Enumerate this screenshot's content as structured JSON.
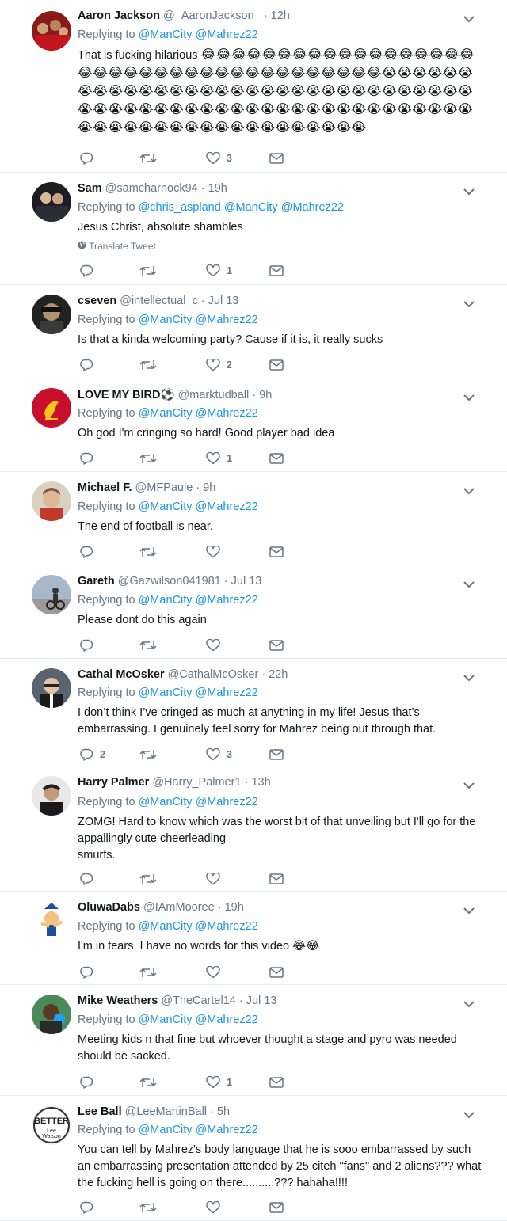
{
  "tweets": [
    {
      "name": "Aaron Jackson",
      "handle": "@_AaronJackson_",
      "time": "12h",
      "replying": "Replying to",
      "mentions": [
        "@ManCity",
        "@Mahrez22"
      ],
      "text": "That is fucking hilarious",
      "emoji_line": "😂😂😂😂😂😂😂😂😂😂😂😂😂😂😂😂😂😂😂😂😂😂😂😂😂😂😂😂😂😂😂😂😂😂😂😂😂😂😭😭😭😭😭😭😭😭😭😭😭😭😭😭😭😭😭😭😭😭😭😭😭😭😭😭😭😭😭😭😭😭😭😭😭😭😭😭😭😭😭😭😭😭😭😭😭😭😭😭😭😭😭😭😭😭😭😭😭😭😭😭😭😭😭😭😭😭😭😭😭😭😭😭😭😭😭",
      "reply_count": "",
      "retweet_count": "",
      "like_count": "3"
    },
    {
      "name": "Sam",
      "handle": "@samcharnock94",
      "time": "19h",
      "replying": "Replying to",
      "mentions": [
        "@chris_aspland",
        "@ManCity",
        "@Mahrez22"
      ],
      "text": "Jesus Christ, absolute shambles",
      "translate": "Translate Tweet",
      "reply_count": "",
      "retweet_count": "",
      "like_count": "1"
    },
    {
      "name": "cseven",
      "handle": "@intellectual_c",
      "time": "Jul 13",
      "replying": "Replying to",
      "mentions": [
        "@ManCity",
        "@Mahrez22"
      ],
      "text": "Is that a kinda welcoming party? Cause if it is, it really sucks",
      "reply_count": "",
      "retweet_count": "",
      "like_count": "2"
    },
    {
      "name": "LOVE MY BIRD⚽",
      "handle": "@marktudball",
      "time": "9h",
      "replying": "Replying to",
      "mentions": [
        "@ManCity",
        "@Mahrez22"
      ],
      "text": "Oh god I'm cringing so hard! Good player bad idea",
      "reply_count": "",
      "retweet_count": "",
      "like_count": "1"
    },
    {
      "name": "Michael F.",
      "handle": "@MFPaule",
      "time": "9h",
      "replying": "Replying to",
      "mentions": [
        "@ManCity",
        "@Mahrez22"
      ],
      "text": "The end of football is near.",
      "reply_count": "",
      "retweet_count": "",
      "like_count": ""
    },
    {
      "name": "Gareth",
      "handle": "@Gazwilson041981",
      "time": "Jul 13",
      "replying": "Replying to",
      "mentions": [
        "@ManCity",
        "@Mahrez22"
      ],
      "text": "Please dont do this again",
      "reply_count": "",
      "retweet_count": "",
      "like_count": ""
    },
    {
      "name": "Cathal McOsker",
      "handle": "@CathalMcOsker",
      "time": "22h",
      "replying": "Replying to",
      "mentions": [
        "@ManCity",
        "@Mahrez22"
      ],
      "text": "I don’t think I’ve cringed as much at anything in my life! Jesus that’s embarrassing. I genuinely feel sorry for Mahrez being out through that.",
      "reply_count": "2",
      "retweet_count": "",
      "like_count": "3"
    },
    {
      "name": "Harry Palmer",
      "handle": "@Harry_Palmer1",
      "time": "13h",
      "replying": "Replying to",
      "mentions": [
        "@ManCity",
        "@Mahrez22"
      ],
      "text": "ZOMG! Hard to know which was the worst bit of that unveiling but I'll go for the appallingly cute cheerleading\nsmurfs.",
      "reply_count": "",
      "retweet_count": "",
      "like_count": ""
    },
    {
      "name": "OluwaDabs",
      "handle": "@IAmMooree",
      "time": "19h",
      "replying": "Replying to",
      "mentions": [
        "@ManCity",
        "@Mahrez22"
      ],
      "text": "I'm in tears. I have no words for this video 😂😂",
      "reply_count": "",
      "retweet_count": "",
      "like_count": ""
    },
    {
      "name": "Mike Weathers",
      "handle": "@TheCartel14",
      "time": "Jul 13",
      "replying": "Replying to",
      "mentions": [
        "@ManCity",
        "@Mahrez22"
      ],
      "text": "Meeting kids n that fine but whoever thought a stage and pyro was needed should be sacked.",
      "reply_count": "",
      "retweet_count": "",
      "like_count": "1"
    },
    {
      "name": "Lee Ball",
      "handle": "@LeeMartinBall",
      "time": "5h",
      "replying": "Replying to",
      "mentions": [
        "@ManCity",
        "@Mahrez22"
      ],
      "text": "You can tell by Mahrez's body language that he is sooo embarrassed by such an embarrassing presentation attended by 25 citeh \"fans\" and 2 aliens??? what the fucking hell is going on there..........??? hahaha!!!!",
      "avatar_text": "BETTER",
      "reply_count": "",
      "retweet_count": "",
      "like_count": ""
    }
  ],
  "icons": {
    "reply": "reply-icon",
    "retweet": "retweet-icon",
    "like": "heart-icon",
    "dm": "envelope-icon",
    "menu": "chevron-down-icon",
    "translate": "globe-icon"
  },
  "colors": {
    "text": "#14171a",
    "muted": "#657786",
    "link": "#1b95e0",
    "border": "#e6ecf0"
  }
}
